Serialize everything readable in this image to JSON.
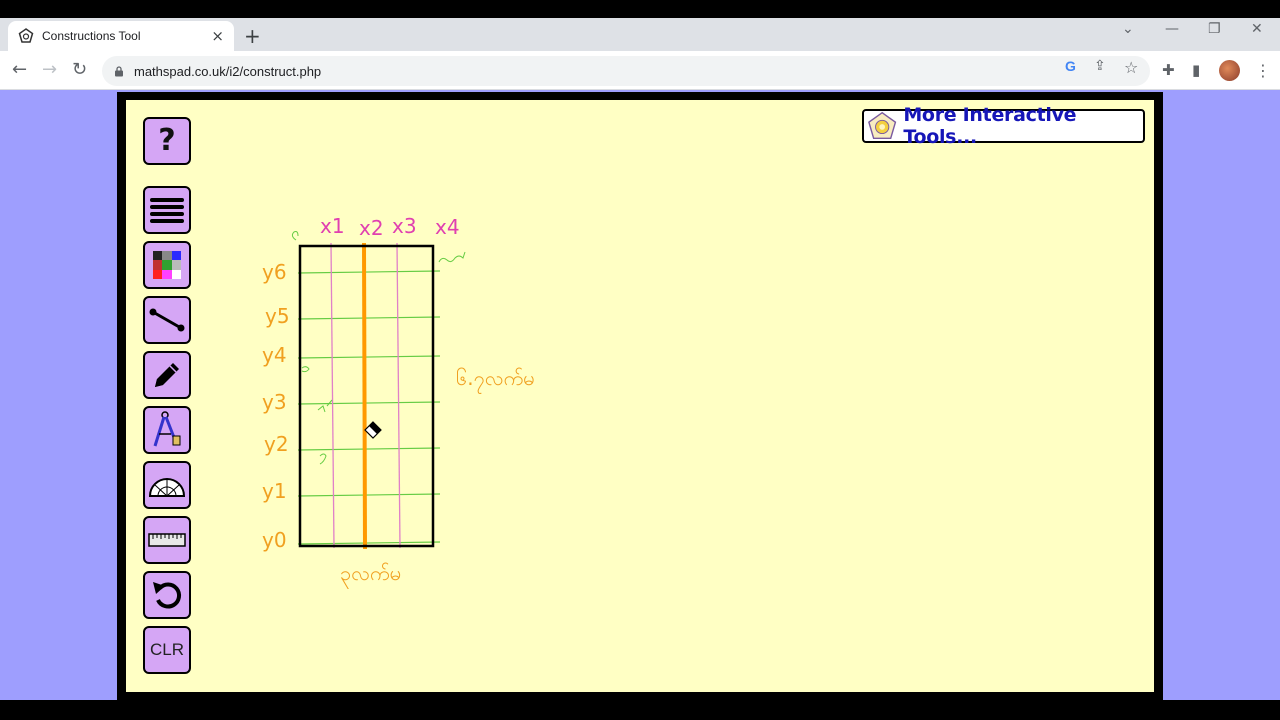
{
  "browser": {
    "tab_title": "Constructions Tool",
    "tab_close": "×",
    "new_tab": "+",
    "url": "mathspad.co.uk/i2/construct.php",
    "nav_back": "←",
    "nav_forward": "→",
    "nav_reload": "↻",
    "win_dropdown": "⌄",
    "win_minimize": "—",
    "win_restore": "❐",
    "win_close": "✕",
    "omni_google": "G",
    "omni_share": "⇪",
    "omni_star": "☆",
    "ext_puzzle": "✚",
    "sidepanel": "▮",
    "menu": "⋮"
  },
  "tools": {
    "help_label": "?",
    "clear_label": "CLR"
  },
  "more_tools_label": "More Interactive Tools...",
  "drawing": {
    "x_labels": [
      "x1",
      "x2",
      "x3",
      "x4"
    ],
    "y_labels": [
      "y6",
      "y5",
      "y4",
      "y3",
      "y2",
      "y1",
      "y0"
    ],
    "right_note": "၆.၇လက်မ",
    "bottom_note": "၃လက်မ",
    "colors": {
      "x_label": "#e040b0",
      "y_label": "#f0a020",
      "grid_green": "#66cc44",
      "grid_pink": "#e080c8",
      "orange_line": "#ff9900",
      "rect": "#000000"
    }
  }
}
